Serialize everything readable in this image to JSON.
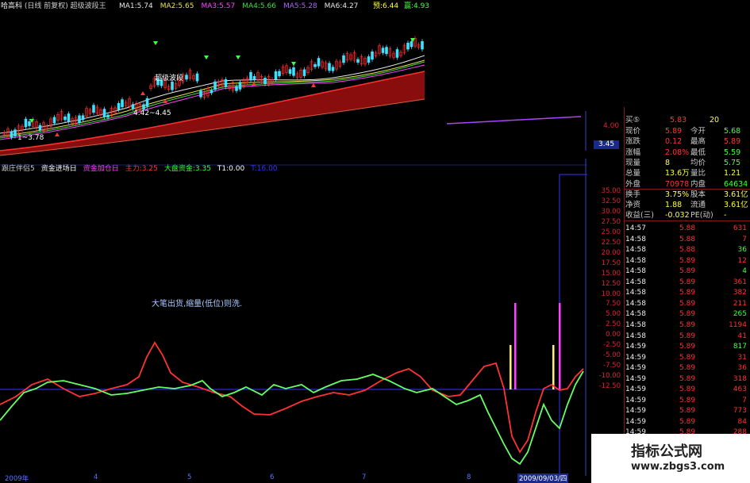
{
  "upper_header": {
    "stock": "哈高科",
    "period": "(日线 前复权)",
    "indicator": "超级波段王",
    "ma": [
      {
        "label": "MA1:5.74",
        "color": "#e8e8e8"
      },
      {
        "label": "MA2:5.65",
        "color": "#e8e84a"
      },
      {
        "label": "MA3:5.57",
        "color": "#ff44ff"
      },
      {
        "label": "MA4:5.66",
        "color": "#44dd44"
      },
      {
        "label": "MA5:5.28",
        "color": "#aa66ff"
      },
      {
        "label": "MA6:4.27",
        "color": "#e8e8e8"
      }
    ],
    "buy": "预:6.44",
    "sell": "赢:4.93"
  },
  "upper_annotations": {
    "label1": "超级波段",
    "label2": "4.42~4.45",
    "label3": "1~3.78"
  },
  "lower_header": {
    "name": "跟庄伴侣5",
    "items": [
      {
        "label": "资金进场日",
        "color": "#ffffff"
      },
      {
        "label": "资金加仓日",
        "color": "#ff44ff"
      },
      {
        "label": "主力:3.25",
        "color": "#ff3333"
      },
      {
        "label": "大盘资金:3.35",
        "color": "#44ff44"
      },
      {
        "label": "T1:0.00",
        "color": "#ffffff"
      },
      {
        "label": "T:16.00",
        "color": "#3333ff"
      }
    ]
  },
  "annotation_text": "大笔出货,缩量(低位)则洗.",
  "mid_axis": {
    "top_value": "4.00",
    "cursor_value": "3.45"
  },
  "lower_axis": [
    "35.00",
    "32.50",
    "30.00",
    "27.50",
    "25.00",
    "22.50",
    "20.00",
    "17.50",
    "15.00",
    "12.50",
    "10.00",
    "7.50",
    "5.00",
    "2.50",
    "0.00",
    "-2.50",
    "-5.00",
    "-7.50",
    "-10.00",
    "-12.50"
  ],
  "x_axis": {
    "year_label": "2009年",
    "months": [
      "4",
      "5",
      "6",
      "7",
      "8"
    ],
    "cursor_date": "2009/09/03/四"
  },
  "quote": {
    "buy5": {
      "label": "买⑤",
      "price": "5.83",
      "vol": "20"
    },
    "rows": [
      {
        "l1": "现价",
        "v1": "5.89",
        "l2": "今开",
        "v2": "5.68",
        "c1": "#ff3333",
        "c2": "#44ff44"
      },
      {
        "l1": "涨跌",
        "v1": "0.12",
        "l2": "最高",
        "v2": "5.89",
        "c1": "#ff3333",
        "c2": "#ff3333"
      },
      {
        "l1": "涨幅",
        "v1": "2.08%",
        "l2": "最低",
        "v2": "5.59",
        "c1": "#ff3333",
        "c2": "#44ff44"
      },
      {
        "l1": "现量",
        "v1": "8",
        "l2": "均价",
        "v2": "5.75",
        "c1": "#ffff44",
        "c2": "#44ff44"
      },
      {
        "l1": "总量",
        "v1": "13.6万",
        "l2": "量比",
        "v2": "1.21",
        "c1": "#ffff44",
        "c2": "#ffff44"
      },
      {
        "l1": "外盘",
        "v1": "70978",
        "l2": "内盘",
        "v2": "64634",
        "c1": "#ff3333",
        "c2": "#44ff44"
      },
      {
        "l1": "换手",
        "v1": "3.75%",
        "l2": "股本",
        "v2": "3.61亿",
        "c1": "#ffff44",
        "c2": "#ffff44"
      },
      {
        "l1": "净资",
        "v1": "1.88",
        "l2": "流通",
        "v2": "3.61亿",
        "c1": "#ffff44",
        "c2": "#ffff44"
      },
      {
        "l1": "收益(三)",
        "v1": "-0.032",
        "l2": "PE(动)",
        "v2": "-",
        "c1": "#ffff44",
        "c2": "#ffff44"
      }
    ]
  },
  "trades": [
    {
      "t": "14:57",
      "p": "5.88",
      "v": "631",
      "vc": "#ff3333"
    },
    {
      "t": "14:58",
      "p": "5.88",
      "v": "7",
      "vc": "#ff3333"
    },
    {
      "t": "14:58",
      "p": "5.88",
      "v": "36",
      "vc": "#44ff44"
    },
    {
      "t": "14:58",
      "p": "5.89",
      "v": "12",
      "vc": "#ff3333"
    },
    {
      "t": "14:58",
      "p": "5.89",
      "v": "4",
      "vc": "#44ff44"
    },
    {
      "t": "14:58",
      "p": "5.89",
      "v": "361",
      "vc": "#ff3333"
    },
    {
      "t": "14:58",
      "p": "5.89",
      "v": "382",
      "vc": "#ff3333"
    },
    {
      "t": "14:58",
      "p": "5.89",
      "v": "211",
      "vc": "#ff3333"
    },
    {
      "t": "14:58",
      "p": "5.89",
      "v": "265",
      "vc": "#44ff44"
    },
    {
      "t": "14:58",
      "p": "5.89",
      "v": "1194",
      "vc": "#ff3333"
    },
    {
      "t": "14:58",
      "p": "5.89",
      "v": "41",
      "vc": "#ff3333"
    },
    {
      "t": "14:59",
      "p": "5.89",
      "v": "817",
      "vc": "#44ff44"
    },
    {
      "t": "14:59",
      "p": "5.89",
      "v": "31",
      "vc": "#ff3333"
    },
    {
      "t": "14:59",
      "p": "5.89",
      "v": "36",
      "vc": "#ff3333"
    },
    {
      "t": "14:59",
      "p": "5.89",
      "v": "318",
      "vc": "#ff3333"
    },
    {
      "t": "14:59",
      "p": "5.89",
      "v": "463",
      "vc": "#ff3333"
    },
    {
      "t": "14:59",
      "p": "5.89",
      "v": "7",
      "vc": "#ff3333"
    },
    {
      "t": "14:59",
      "p": "5.89",
      "v": "773",
      "vc": "#ff3333"
    },
    {
      "t": "14:59",
      "p": "5.89",
      "v": "84",
      "vc": "#ff3333"
    },
    {
      "t": "14:59",
      "p": "5.89",
      "v": "288",
      "vc": "#ff3333"
    }
  ],
  "watermark": {
    "title": "指标公式网",
    "url": "www.zbgs3.com"
  },
  "colors": {
    "red": "#ff3333",
    "green": "#44ff44",
    "blue": "#3333ff",
    "magenta": "#ff44ff",
    "yellow": "#ffff44"
  }
}
